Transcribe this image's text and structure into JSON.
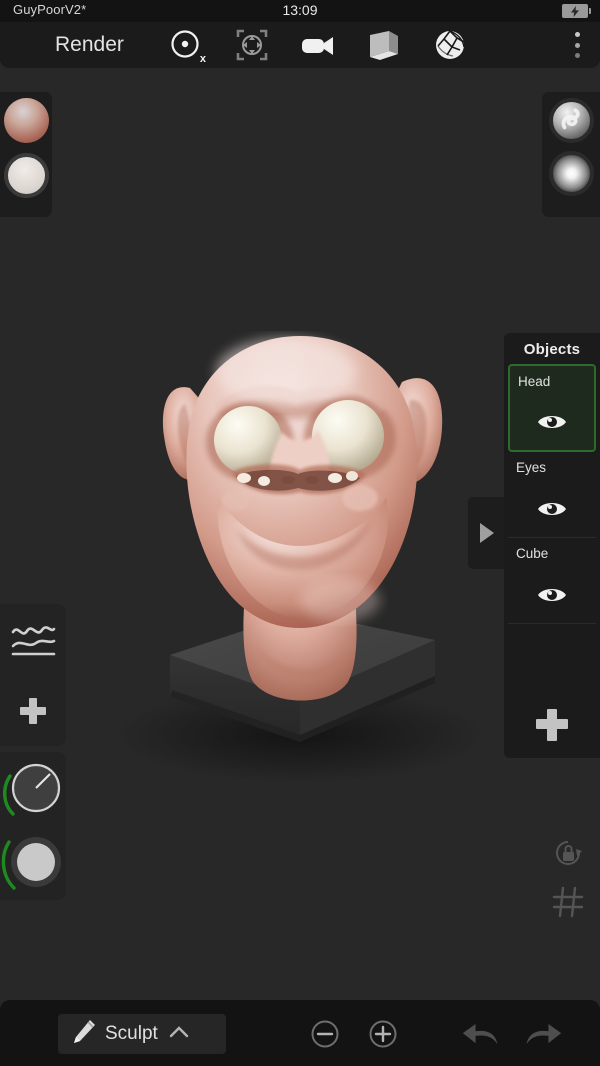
{
  "app": {
    "project_title": "GuyPoorV2*",
    "mode_label": "Render",
    "background_color": "#282828",
    "panel_color": "#1b1b1b",
    "accent_color": "#2d6b2d"
  },
  "status_bar": {
    "title": "GuyPoorV2*",
    "clock": "13:09",
    "battery_icon": "battery-charging-icon"
  },
  "toolbar": {
    "mode_label": "Render",
    "icons": [
      {
        "name": "symmetry-x-icon",
        "glyph": "circle-dot",
        "axis_label": "x"
      },
      {
        "name": "gizmo-move-icon",
        "glyph": "transform-gizmo"
      },
      {
        "name": "camera-icon",
        "glyph": "video-camera"
      },
      {
        "name": "box-icon",
        "glyph": "open-cube"
      },
      {
        "name": "wireframe-sphere-icon",
        "glyph": "sphere-wireframe"
      }
    ],
    "overflow_menu": "more-options-icon"
  },
  "material_dock_left": {
    "name": "material-swatches",
    "swatches": [
      {
        "name": "material-swatch-skin",
        "label": "skin",
        "color": "#b07a68"
      },
      {
        "name": "material-swatch-white",
        "label": "white",
        "color": "#e2dcd7"
      }
    ]
  },
  "material_dock_right": {
    "name": "environment-swatches",
    "swatches": [
      {
        "name": "matcap-swatch-swirl",
        "label": "swirl matcap",
        "color": "#b5b5b5"
      },
      {
        "name": "matcap-swatch-glow",
        "label": "glow matcap",
        "color": "#f2f2f2"
      }
    ]
  },
  "left_rail": {
    "groups": [
      {
        "name": "brush-settings-group",
        "items": [
          {
            "name": "curve-editor-icon",
            "label": "curve"
          },
          {
            "name": "add-brush-icon",
            "label": "add"
          }
        ]
      },
      {
        "name": "brush-sliders-group",
        "items": [
          {
            "name": "brush-size-knob",
            "label": "size",
            "arc_color": "#1f8a1f",
            "value_pct": 62
          },
          {
            "name": "brush-intensity-knob",
            "label": "intensity",
            "arc_color": "#1f8a1f",
            "value_pct": 70
          }
        ]
      }
    ]
  },
  "objects_panel": {
    "title": "Objects",
    "collapse_toggle": "panel-collapse-icon",
    "add_button_label": "add-object-icon",
    "items": [
      {
        "name": "Head",
        "selected": true,
        "visibility_icon": "eye-icon"
      },
      {
        "name": "Eyes",
        "selected": false,
        "visibility_icon": "eye-icon"
      },
      {
        "name": "Cube",
        "selected": false,
        "visibility_icon": "eye-icon"
      }
    ]
  },
  "viewport_widgets": [
    {
      "name": "lock-rotation-icon",
      "label": "lock rotation"
    },
    {
      "name": "grid-icon",
      "label": "grid"
    }
  ],
  "viewport": {
    "scene_objects": [
      "Head",
      "Eyes",
      "Cube"
    ],
    "model_description": "goblin head sculpt on cube slab",
    "skin_color": "#d7a392",
    "eye_color": "#e8e2d2",
    "base_color": "#3d3d3d"
  },
  "bottom_bar": {
    "mode_button": {
      "name": "sculpt-mode-button",
      "label": "Sculpt",
      "icon": "brush-icon",
      "chevron": "chevron-up-icon"
    },
    "actions": [
      {
        "name": "zoom-out-button",
        "icon": "minus-circle-icon",
        "label": "zoom out"
      },
      {
        "name": "zoom-in-button",
        "icon": "plus-circle-icon",
        "label": "zoom in"
      },
      {
        "name": "undo-button",
        "icon": "undo-arrow-icon",
        "label": "undo"
      },
      {
        "name": "redo-button",
        "icon": "redo-arrow-icon",
        "label": "redo"
      }
    ]
  }
}
